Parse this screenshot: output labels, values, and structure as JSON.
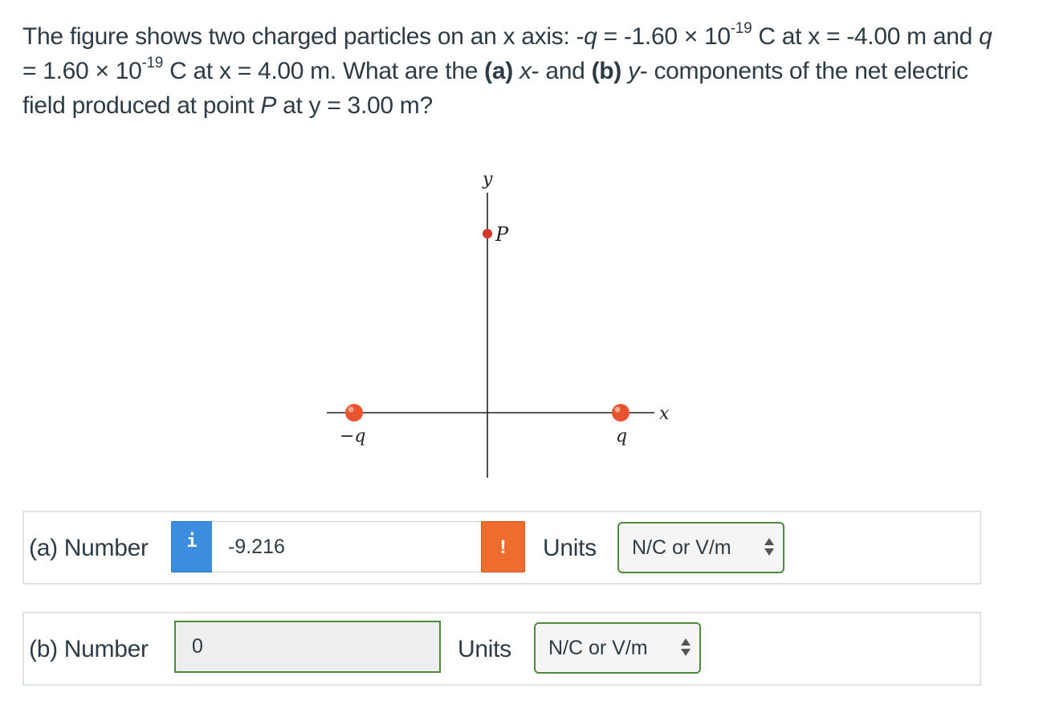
{
  "question": {
    "p1": "The figure shows two charged particles on an x axis: -",
    "q1": "q",
    "p2": " = -1.60 × 10",
    "exp1": "-19",
    "p3": " C at x = -4.00 m and ",
    "q2": "q",
    "p4": " = 1.60 × 10",
    "exp2": "-19",
    "p5": " C at x = 4.00 m. What are the ",
    "a_tag": "(a)",
    "p6": " ",
    "x_comp": "x",
    "p7": "- and ",
    "b_tag": "(b)",
    "p8": " ",
    "y_comp": "y",
    "p9": "- components of the net electric field produced at point ",
    "point": "P",
    "p10": " at y = 3.00 m?"
  },
  "figure": {
    "y_axis_label": "y",
    "x_axis_label": "x",
    "point_label": "P",
    "neg_charge_label": "−q",
    "pos_charge_label": "q",
    "charge_color": "#e8542f",
    "point_color": "#d9342b"
  },
  "part_a": {
    "label": "(a) Number",
    "info_icon": "i",
    "value": "-9.216",
    "warning_icon": "!",
    "units_label": "Units",
    "units_value": "N/C or V/m"
  },
  "part_b": {
    "label": "(b) Number",
    "value": "0",
    "units_label": "Units",
    "units_value": "N/C or V/m"
  }
}
